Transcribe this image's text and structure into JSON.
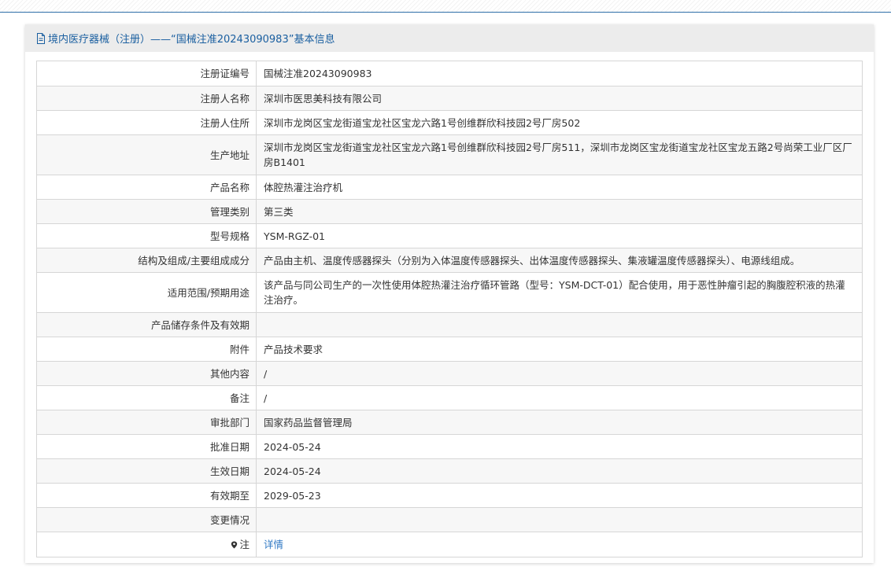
{
  "header": {
    "title": "境内医疗器械（注册）——“国械注准20243090983”基本信息"
  },
  "rows": [
    {
      "label": "注册证编号",
      "value": "国械注准20243090983"
    },
    {
      "label": "注册人名称",
      "value": "深圳市医思美科技有限公司"
    },
    {
      "label": "注册人住所",
      "value": "深圳市龙岗区宝龙街道宝龙社区宝龙六路1号创维群欣科技园2号厂房502"
    },
    {
      "label": "生产地址",
      "value": "深圳市龙岗区宝龙街道宝龙社区宝龙六路1号创维群欣科技园2号厂房511，深圳市龙岗区宝龙街道宝龙社区宝龙五路2号尚荣工业厂区厂房B1401"
    },
    {
      "label": "产品名称",
      "value": "体腔热灌注治疗机"
    },
    {
      "label": "管理类别",
      "value": "第三类"
    },
    {
      "label": "型号规格",
      "value": "YSM-RGZ-01"
    },
    {
      "label": "结构及组成/主要组成成分",
      "value": "产品由主机、温度传感器探头（分别为入体温度传感器探头、出体温度传感器探头、集液罐温度传感器探头）、电源线组成。"
    },
    {
      "label": "适用范围/预期用途",
      "value": "该产品与同公司生产的一次性使用体腔热灌注治疗循环管路（型号：YSM-DCT-01）配合使用，用于恶性肿瘤引起的胸腹腔积液的热灌注治疗。"
    },
    {
      "label": "产品储存条件及有效期",
      "value": ""
    },
    {
      "label": "附件",
      "value": "产品技术要求"
    },
    {
      "label": "其他内容",
      "value": "/"
    },
    {
      "label": "备注",
      "value": "/"
    },
    {
      "label": "审批部门",
      "value": "国家药品监督管理局"
    },
    {
      "label": "批准日期",
      "value": "2024-05-24"
    },
    {
      "label": "生效日期",
      "value": "2024-05-24"
    },
    {
      "label": "有效期至",
      "value": "2029-05-23"
    },
    {
      "label": "变更情况",
      "value": ""
    },
    {
      "label": "注",
      "value": "详情"
    }
  ],
  "colors": {
    "header_text": "#1a5fa0",
    "link": "#2f78c4",
    "border": "#d6d6d6"
  },
  "icons": {
    "header": "document-icon",
    "note": "map-pin-icon"
  }
}
